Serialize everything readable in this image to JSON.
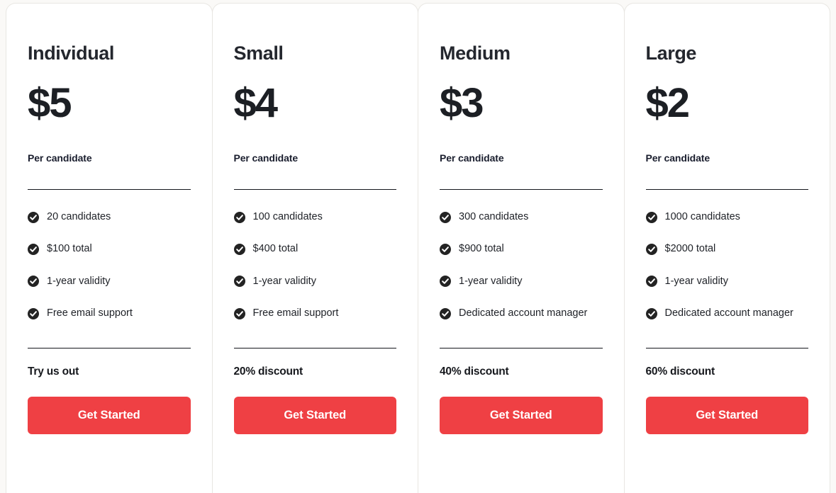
{
  "theme": {
    "page_background": "#faf9f7",
    "card_background": "#ffffff",
    "card_border": "#e8e6e2",
    "accent": "#ef4044",
    "text_primary": "#1c1f24",
    "text_unit": "#1a1e2e",
    "divider": "#14161c",
    "check_icon_fill": "#232323"
  },
  "icons": {
    "check": "check-circle-icon"
  },
  "plans": [
    {
      "name": "Individual",
      "price": "$5",
      "unit": "Per candidate",
      "features": [
        "20 candidates",
        "$100 total",
        "1-year validity",
        "Free email support"
      ],
      "note": "Try us out",
      "cta": "Get Started"
    },
    {
      "name": "Small",
      "price": "$4",
      "unit": "Per candidate",
      "features": [
        "100 candidates",
        "$400 total",
        "1-year validity",
        "Free email support"
      ],
      "note": "20% discount",
      "cta": "Get Started"
    },
    {
      "name": "Medium",
      "price": "$3",
      "unit": "Per candidate",
      "features": [
        "300 candidates",
        "$900 total",
        "1-year validity",
        "Dedicated account manager"
      ],
      "note": "40% discount",
      "cta": "Get Started"
    },
    {
      "name": "Large",
      "price": "$2",
      "unit": "Per candidate",
      "features": [
        "1000 candidates",
        "$2000 total",
        "1-year validity",
        "Dedicated account manager"
      ],
      "note": "60% discount",
      "cta": "Get Started"
    }
  ]
}
